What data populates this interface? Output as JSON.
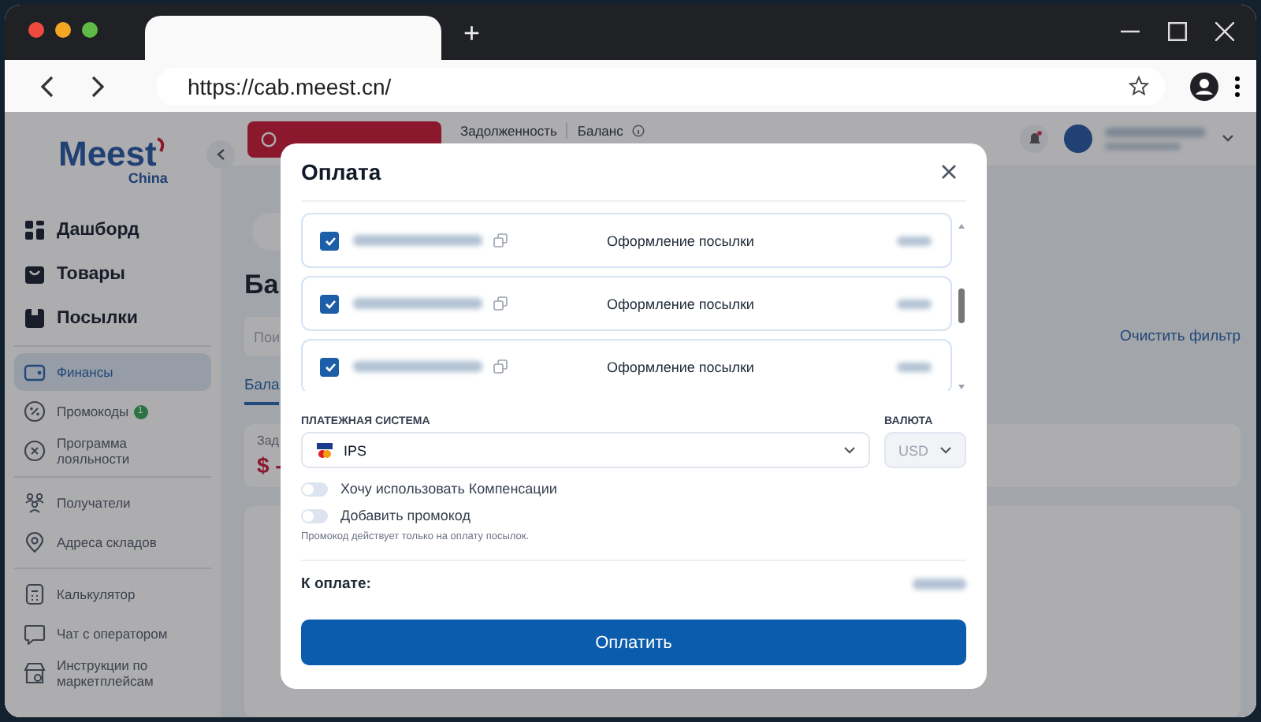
{
  "browser": {
    "new_tab": "+",
    "url": "https://cab.meest.cn/"
  },
  "sidebar": {
    "logo": {
      "brand": "Meest",
      "sub": "China"
    },
    "groups": [
      [
        {
          "label": "Дашборд",
          "kind": "main",
          "selected": false
        },
        {
          "label": "Товары",
          "kind": "main",
          "selected": false
        },
        {
          "label": "Посылки",
          "kind": "main",
          "selected": false
        }
      ],
      [
        {
          "label": "Финансы",
          "kind": "sub",
          "selected": true
        },
        {
          "label": "Промокоды",
          "kind": "sub",
          "selected": false,
          "badge": "1"
        },
        {
          "label": "Программа лояльности",
          "kind": "sub",
          "selected": false
        }
      ],
      [
        {
          "label": "Получатели",
          "kind": "sub",
          "selected": false
        },
        {
          "label": "Адреса складов",
          "kind": "sub",
          "selected": false
        }
      ],
      [
        {
          "label": "Калькулятор",
          "kind": "sub",
          "selected": false
        },
        {
          "label": "Чат с оператором",
          "kind": "sub",
          "selected": false
        },
        {
          "label": "Инструкции по маркетплейсам",
          "kind": "sub",
          "selected": false
        }
      ]
    ]
  },
  "header": {
    "debt_label": "Задолженность",
    "balance_label": "Баланс"
  },
  "main": {
    "heading": "Ба",
    "search_placeholder": "Пои",
    "tabs": [
      {
        "label": "Бала",
        "selected": true
      }
    ],
    "card_label": "Зад",
    "card_value": "$ -",
    "clear_filter": "Очистить фильтр"
  },
  "modal": {
    "title": "Оплата",
    "rows": [
      {
        "checked": true,
        "description": "Оформление посылки"
      },
      {
        "checked": true,
        "description": "Оформление посылки"
      },
      {
        "checked": true,
        "description": "Оформление посылки"
      }
    ],
    "payment": {
      "label": "ПЛАТЕЖНАЯ СИСТЕМА",
      "value": "IPS"
    },
    "currency": {
      "label": "ВАЛЮТА",
      "value": "USD",
      "disabled": true
    },
    "toggles": [
      {
        "label": "Хочу использовать Компенсации",
        "on": false
      },
      {
        "label": "Добавить промокод",
        "on": false
      }
    ],
    "hint": "Промокод действует только на оплату посылок.",
    "total_label": "К оплате:",
    "pay_button": "Оплатить"
  }
}
